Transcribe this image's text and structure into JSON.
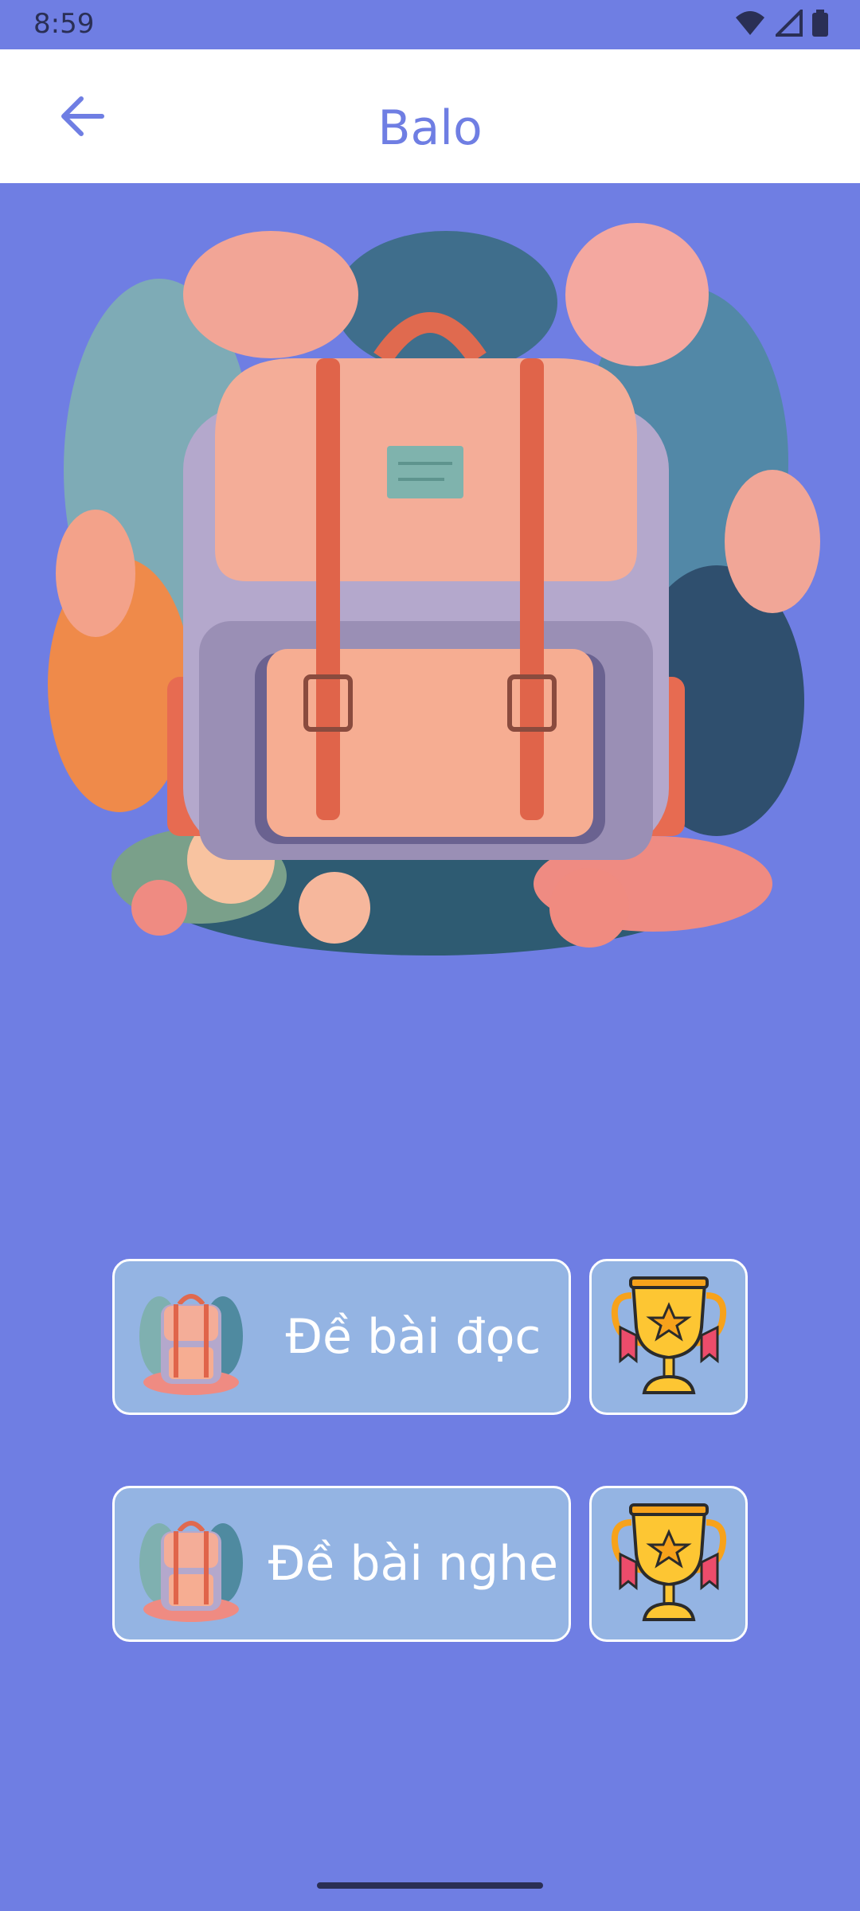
{
  "status_bar": {
    "time": "8:59",
    "icons": [
      "wifi-icon",
      "signal-icon",
      "battery-icon"
    ]
  },
  "app_bar": {
    "title": "Balo",
    "back_icon": "arrow-left-icon"
  },
  "hero": {
    "image": "backpack-illustration"
  },
  "options": [
    {
      "label": "Đề bài đọc",
      "thumb": "backpack-thumbnail",
      "trophy_icon": "trophy-icon"
    },
    {
      "label": "Đề bài nghe",
      "thumb": "backpack-thumbnail",
      "trophy_icon": "trophy-icon"
    }
  ],
  "colors": {
    "background": "#6f7ee3",
    "app_bar": "#ffffff",
    "accent": "#6f7ee3",
    "button_fill": "#94b4e3",
    "button_border": "#ffffff",
    "status_text": "#2a2f55"
  }
}
